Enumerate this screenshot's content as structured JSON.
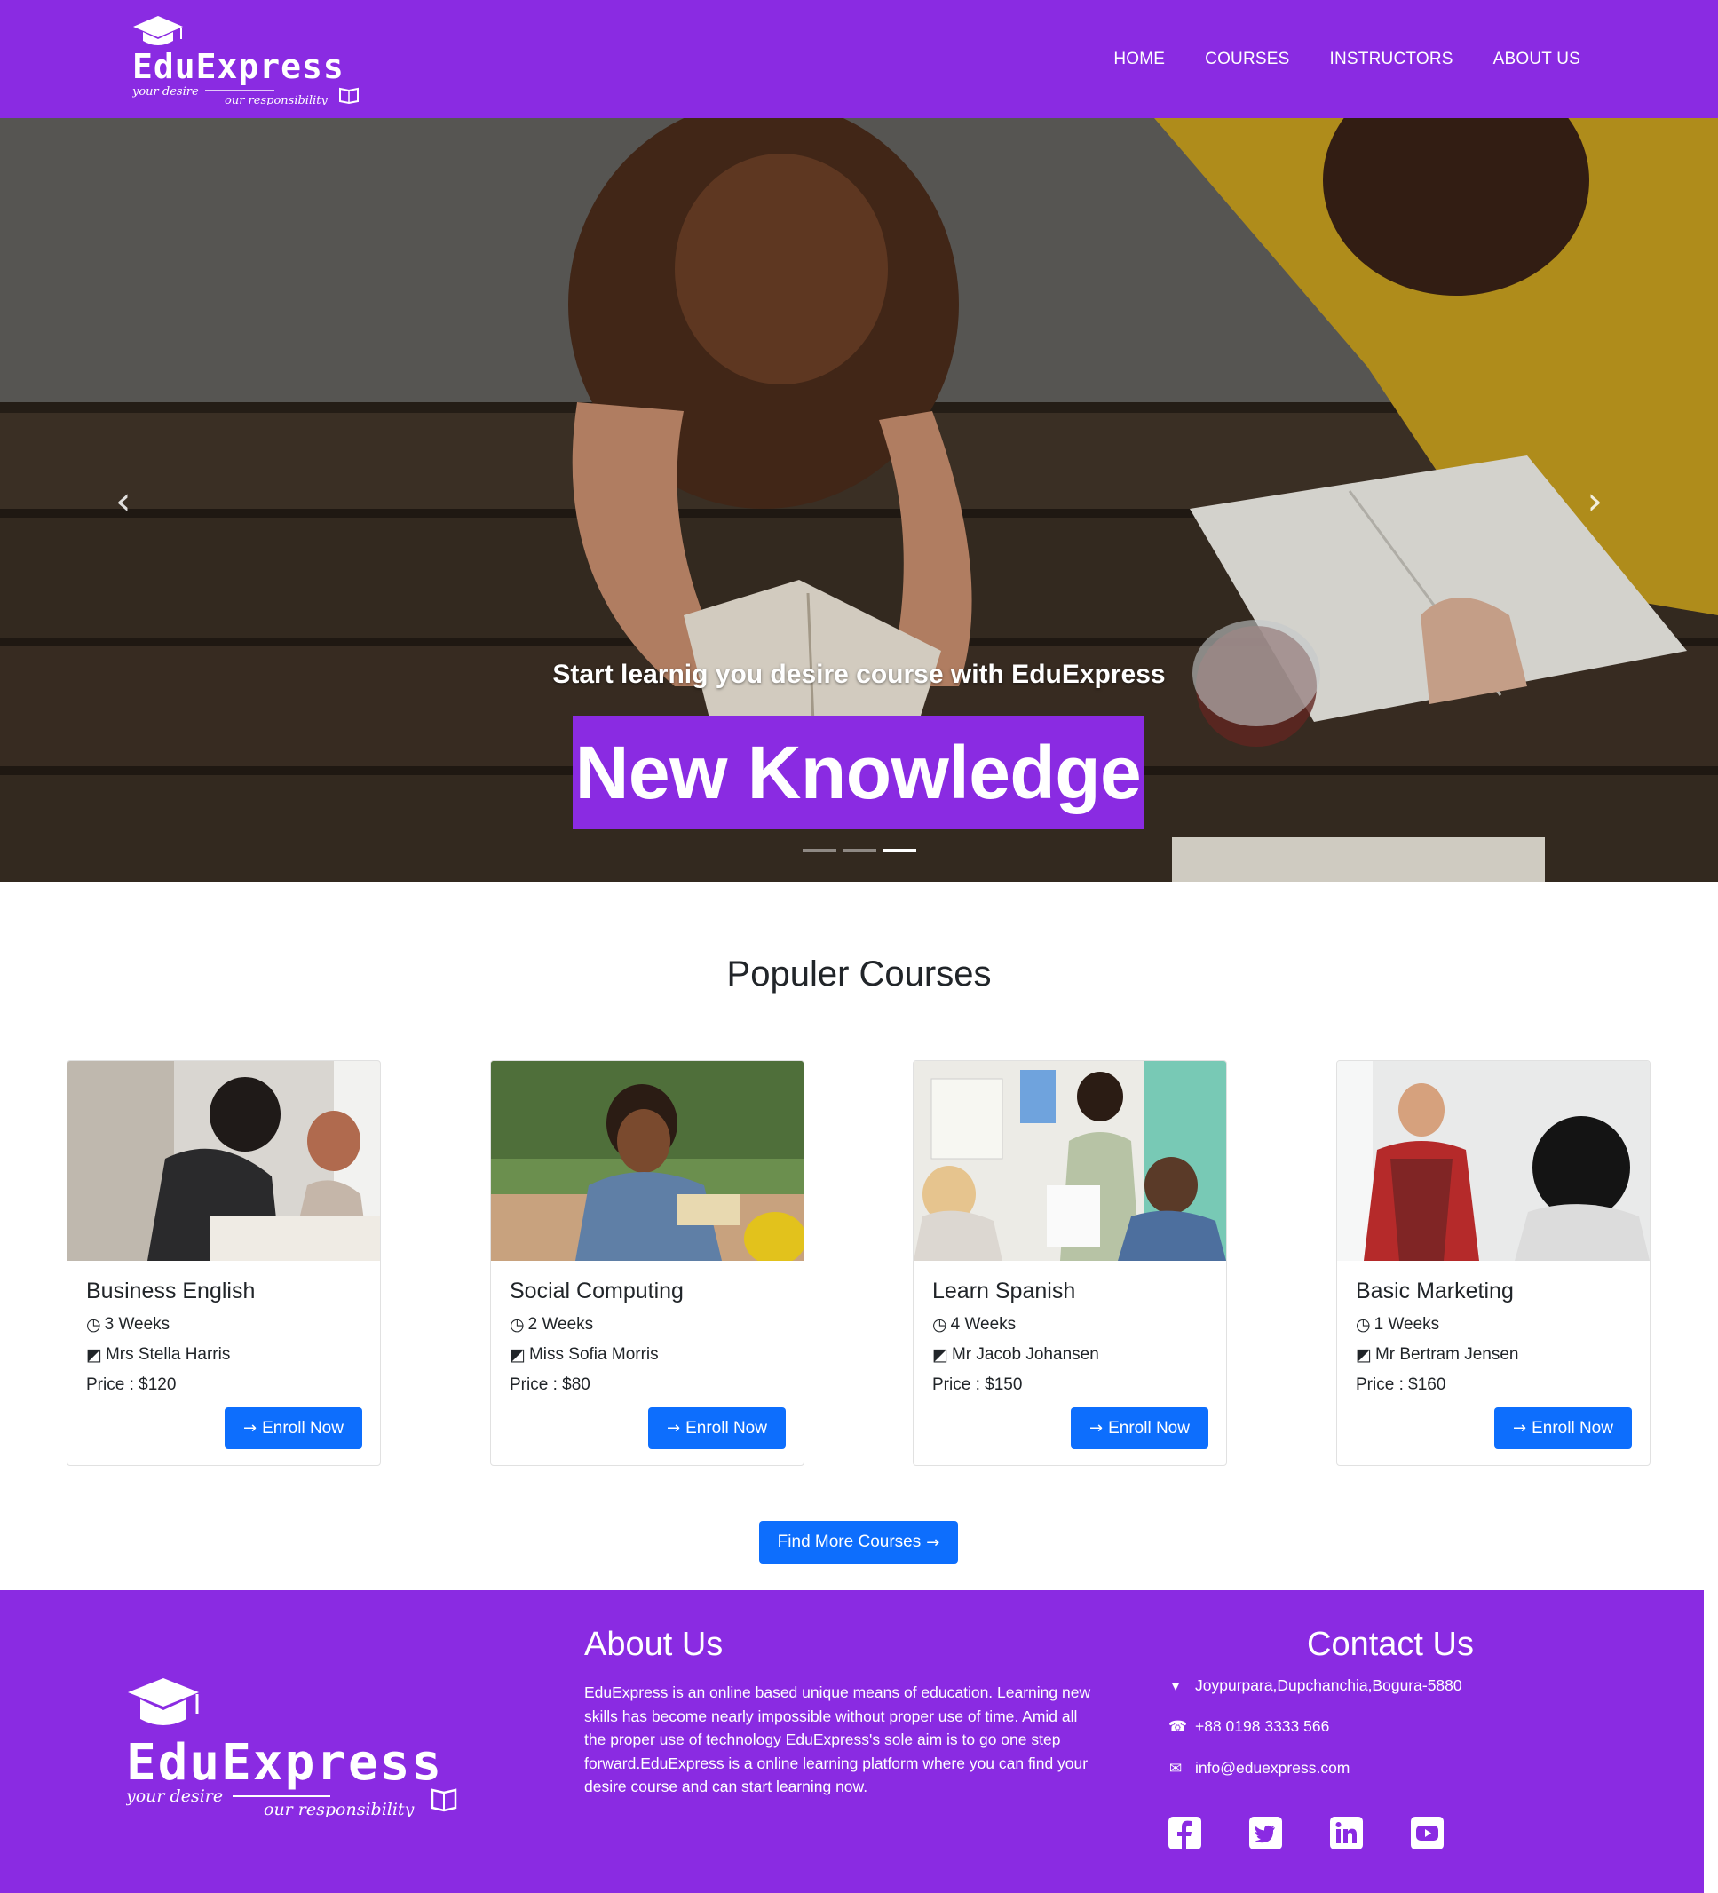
{
  "nav": {
    "logo_text": "EduExpress",
    "logo_tagline_left": "your desire",
    "logo_tagline_right": "our responsibility",
    "links": [
      {
        "label": "HOME"
      },
      {
        "label": "COURSES"
      },
      {
        "label": "INSTRUCTORS"
      },
      {
        "label": "ABOUT US"
      }
    ]
  },
  "hero": {
    "subtitle": "Start learnig you desire course with EduExpress",
    "title": "New Knowledge",
    "prev_icon": "chevron-left-icon",
    "next_icon": "chevron-right-icon",
    "slide_count": 3,
    "active_slide": 3
  },
  "courses": {
    "section_title": "Populer Courses",
    "items": [
      {
        "title": "Business English",
        "duration": "3 Weeks",
        "instructor": "Mrs Stella Harris",
        "price": "Price : $120",
        "button": "Enroll Now"
      },
      {
        "title": "Social Computing",
        "duration": "2 Weeks",
        "instructor": "Miss Sofia Morris",
        "price": "Price : $80",
        "button": "Enroll Now"
      },
      {
        "title": "Learn Spanish",
        "duration": "4 Weeks",
        "instructor": "Mr Jacob Johansen",
        "price": "Price : $150",
        "button": "Enroll Now"
      },
      {
        "title": "Basic Marketing",
        "duration": "1 Weeks",
        "instructor": "Mr Bertram Jensen",
        "price": "Price : $160",
        "button": "Enroll Now"
      }
    ],
    "more_button": "Find More Courses"
  },
  "footer": {
    "logo_text": "EduExpress",
    "logo_tagline_left": "your desire",
    "logo_tagline_right": "our responsibility",
    "about_title": "About Us",
    "about_text": "EduExpress is an online based unique means of education. Learning new skills has become nearly impossible without proper use of time. Amid all the proper use of technology EduExpress's sole aim is to go one step forward.EduExpress is a online learning platform where you can find your desire course and can start learning now.",
    "contact_title": "Contact Us",
    "address": "Joypurpara,Dupchanchia,Bogura-5880",
    "phone": "+88 0198 3333 566",
    "email": "info@eduexpress.com",
    "social": [
      "facebook-icon",
      "twitter-icon",
      "linkedin-icon",
      "youtube-icon"
    ]
  },
  "colors": {
    "brand_purple": "#8a2be2",
    "button_blue": "#0d6efd"
  }
}
